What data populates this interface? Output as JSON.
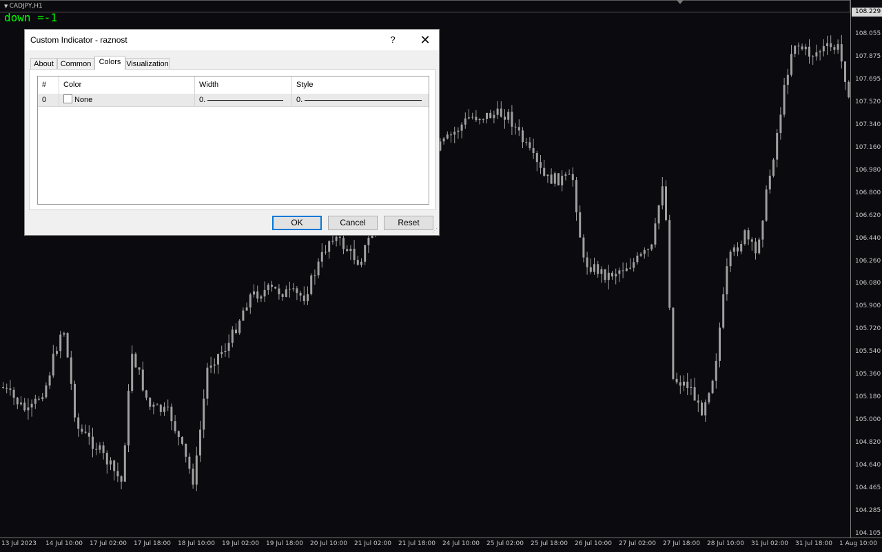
{
  "chart": {
    "symbol": "CADJPY,H1",
    "info_text": "down =-1",
    "current_price": "108.229",
    "colors": {
      "background": "#0b0b0f",
      "candles": "#a0a0a0",
      "info_text": "#00ff00"
    },
    "price_labels": [
      "108.055",
      "107.875",
      "107.695",
      "107.520",
      "107.340",
      "107.160",
      "106.980",
      "106.800",
      "106.620",
      "106.440",
      "106.260",
      "106.080",
      "105.900",
      "105.720",
      "105.540",
      "105.360",
      "105.180",
      "105.000",
      "104.820",
      "104.640",
      "104.465",
      "104.285",
      "104.105"
    ],
    "time_labels": [
      "13 Jul 2023",
      "14 Jul 10:00",
      "17 Jul 02:00",
      "17 Jul 18:00",
      "18 Jul 10:00",
      "19 Jul 02:00",
      "19 Jul 18:00",
      "20 Jul 10:00",
      "21 Jul 02:00",
      "21 Jul 18:00",
      "24 Jul 10:00",
      "25 Jul 02:00",
      "25 Jul 18:00",
      "26 Jul 10:00",
      "27 Jul 02:00",
      "27 Jul 18:00",
      "28 Jul 10:00",
      "31 Jul 02:00",
      "31 Jul 18:00",
      "1 Aug 10:00"
    ]
  },
  "dialog": {
    "title": "Custom Indicator - raznost",
    "help_label": "?",
    "close_label": "✕",
    "tabs": [
      {
        "label": "About",
        "active": false
      },
      {
        "label": "Common",
        "active": false
      },
      {
        "label": "Colors",
        "active": true
      },
      {
        "label": "Visualization",
        "active": false
      }
    ],
    "grid": {
      "headers": [
        "#",
        "Color",
        "Width",
        "Style"
      ],
      "rows": [
        {
          "index": "0",
          "color": "None",
          "width": "0.",
          "style": "0."
        }
      ]
    },
    "buttons": {
      "ok": "OK",
      "cancel": "Cancel",
      "reset": "Reset"
    }
  }
}
